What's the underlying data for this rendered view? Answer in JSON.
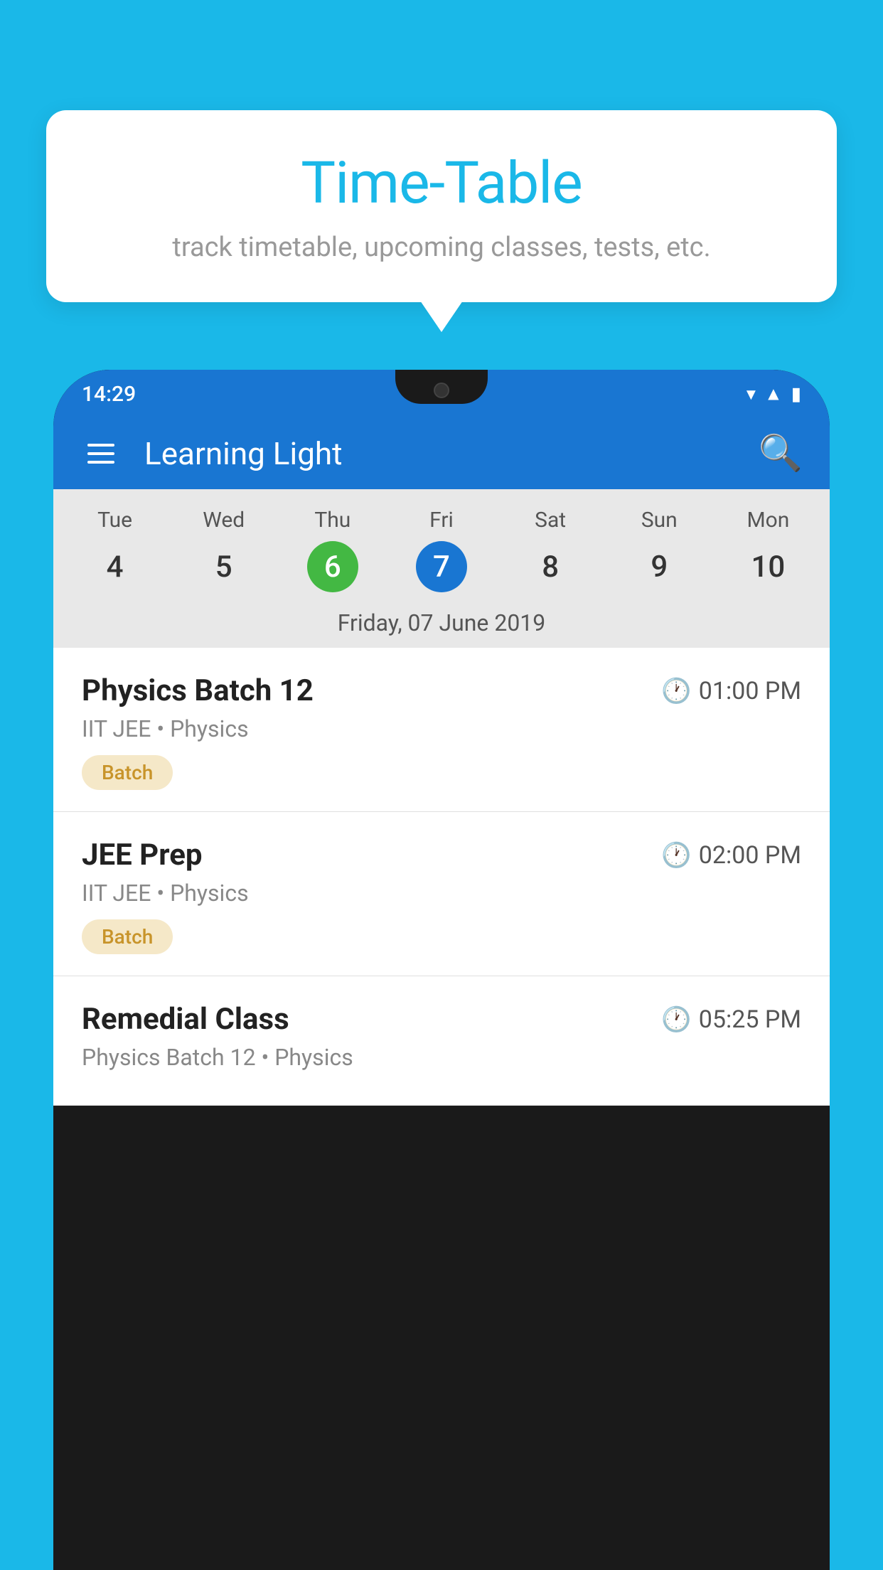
{
  "background_color": "#1ab8e8",
  "speech_bubble": {
    "title": "Time-Table",
    "subtitle": "track timetable, upcoming classes, tests, etc."
  },
  "phone": {
    "status_bar": {
      "time": "14:29"
    },
    "app_name": "Learning Light",
    "calendar": {
      "days": [
        "Tue",
        "Wed",
        "Thu",
        "Fri",
        "Sat",
        "Sun",
        "Mon"
      ],
      "dates": [
        "4",
        "5",
        "6",
        "7",
        "8",
        "9",
        "10"
      ],
      "today_index": 2,
      "selected_index": 3,
      "selected_date_label": "Friday, 07 June 2019"
    },
    "schedule": [
      {
        "title": "Physics Batch 12",
        "time": "01:00 PM",
        "subtitle": "IIT JEE • Physics",
        "badge": "Batch"
      },
      {
        "title": "JEE Prep",
        "time": "02:00 PM",
        "subtitle": "IIT JEE • Physics",
        "badge": "Batch"
      },
      {
        "title": "Remedial Class",
        "time": "05:25 PM",
        "subtitle": "Physics Batch 12 • Physics",
        "badge": null
      }
    ]
  }
}
